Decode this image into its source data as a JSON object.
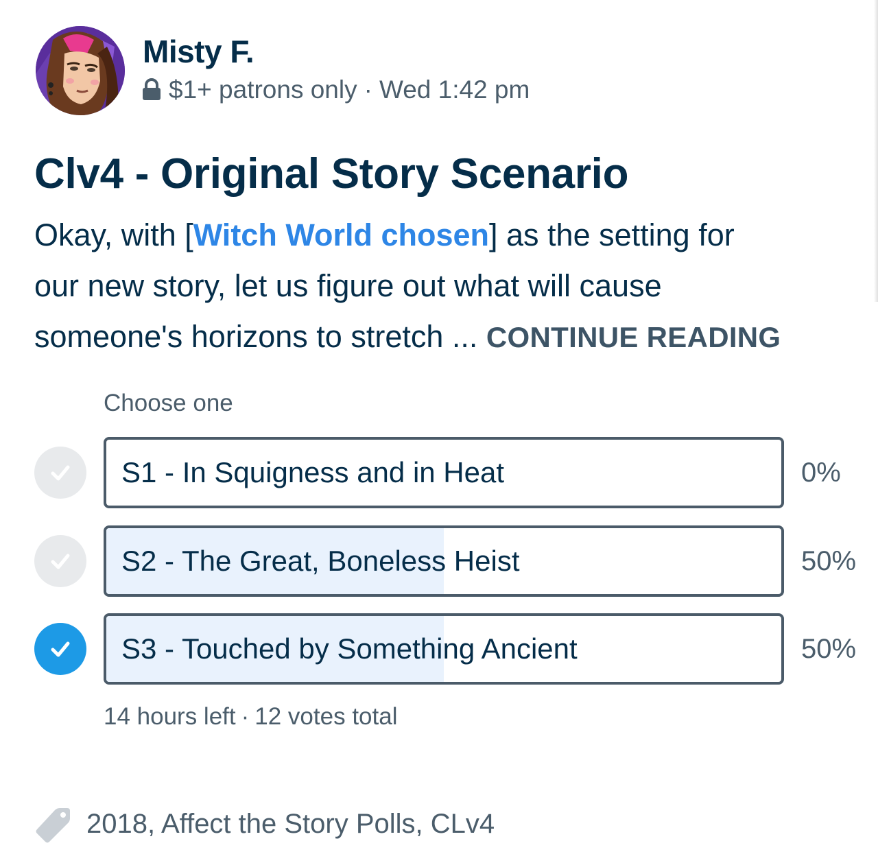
{
  "author": {
    "name": "Misty F.",
    "avatar_icon": "profile-avatar",
    "access": "$1+ patrons only",
    "posted_at": "Wed 1:42 pm",
    "lock_icon": "lock-icon"
  },
  "post": {
    "title": "Clv4 - Original Story Scenario",
    "body": {
      "line1_before": "Okay, with [",
      "link_text": "Witch World chosen",
      "line1_after": "] as the setting for",
      "line2": "our new story, let us figure out what will cause",
      "line3": "someone's horizons to stretch ...",
      "continue_label": "CONTINUE READING"
    }
  },
  "poll": {
    "prompt": "Choose one",
    "options": [
      {
        "label": "S1 - In Squigness and in Heat",
        "percent_label": "0%",
        "share": 0.0,
        "selected": false
      },
      {
        "label": "S2 - The Great, Boneless Heist",
        "percent_label": "50%",
        "share": 0.5,
        "selected": false
      },
      {
        "label": "S3 - Touched by Something Ancient",
        "percent_label": "50%",
        "share": 0.5,
        "selected": true
      }
    ],
    "time_left": "14 hours left",
    "votes_total": "12 votes total",
    "colors": {
      "selected_check": "#1d9ae6",
      "unselected_check": "#e8eaec",
      "result_fill": "#e9f2fd",
      "border": "#4b5b69"
    }
  },
  "tags": {
    "icon": "tag-icon",
    "text": "2018, Affect the Story Polls, CLv4"
  },
  "colors": {
    "text_primary": "#052d49",
    "text_secondary": "#4b5d6b",
    "link": "#2e86e6"
  }
}
